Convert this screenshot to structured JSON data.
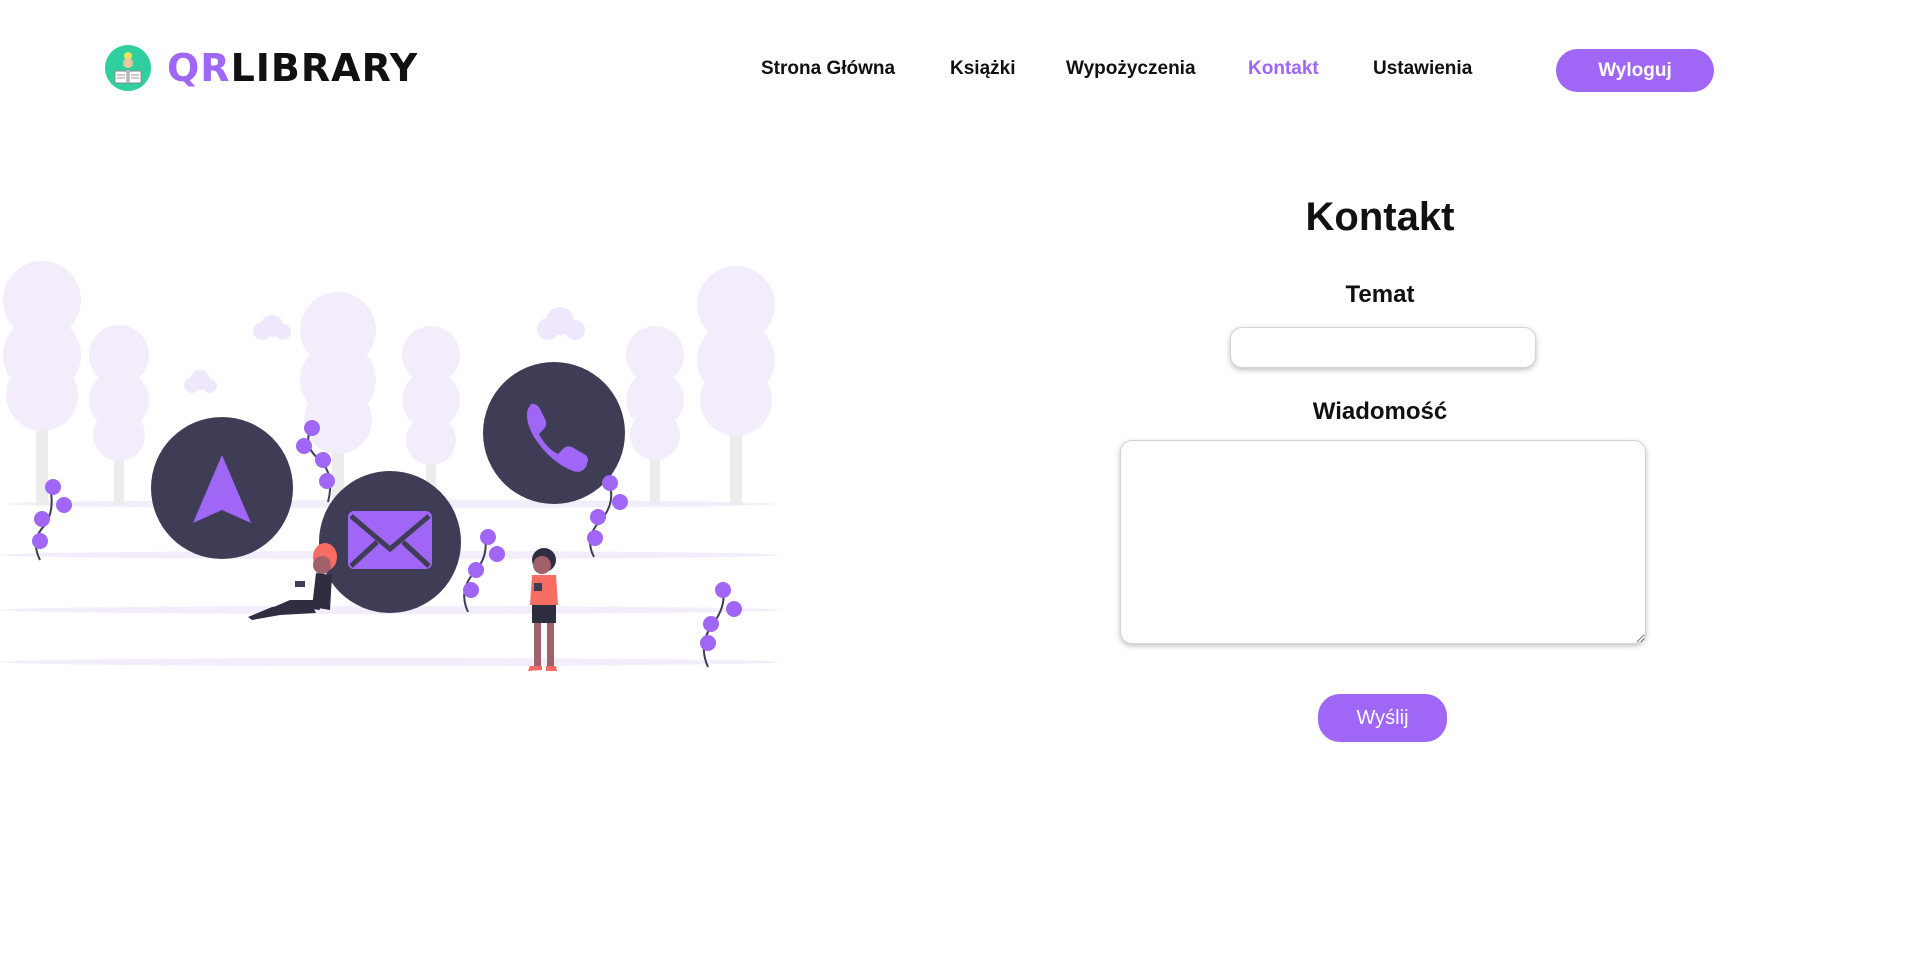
{
  "brand": {
    "name_part1": "QR",
    "name_part2": "LIBRARY",
    "accent_color": "#a066f5"
  },
  "nav": {
    "items": [
      {
        "label": "Strona Główna",
        "active": false
      },
      {
        "label": "Książki",
        "active": false
      },
      {
        "label": "Wypożyczenia",
        "active": false
      },
      {
        "label": "Kontakt",
        "active": true
      },
      {
        "label": "Ustawienia",
        "active": false
      }
    ],
    "logout_label": "Wyloguj"
  },
  "illustration": {
    "icons": [
      "navigation-arrow-icon",
      "envelope-icon",
      "phone-icon"
    ]
  },
  "contact": {
    "title": "Kontakt",
    "subject_label": "Temat",
    "subject_value": "",
    "message_label": "Wiadomość",
    "message_value": "",
    "send_label": "Wyślij"
  }
}
